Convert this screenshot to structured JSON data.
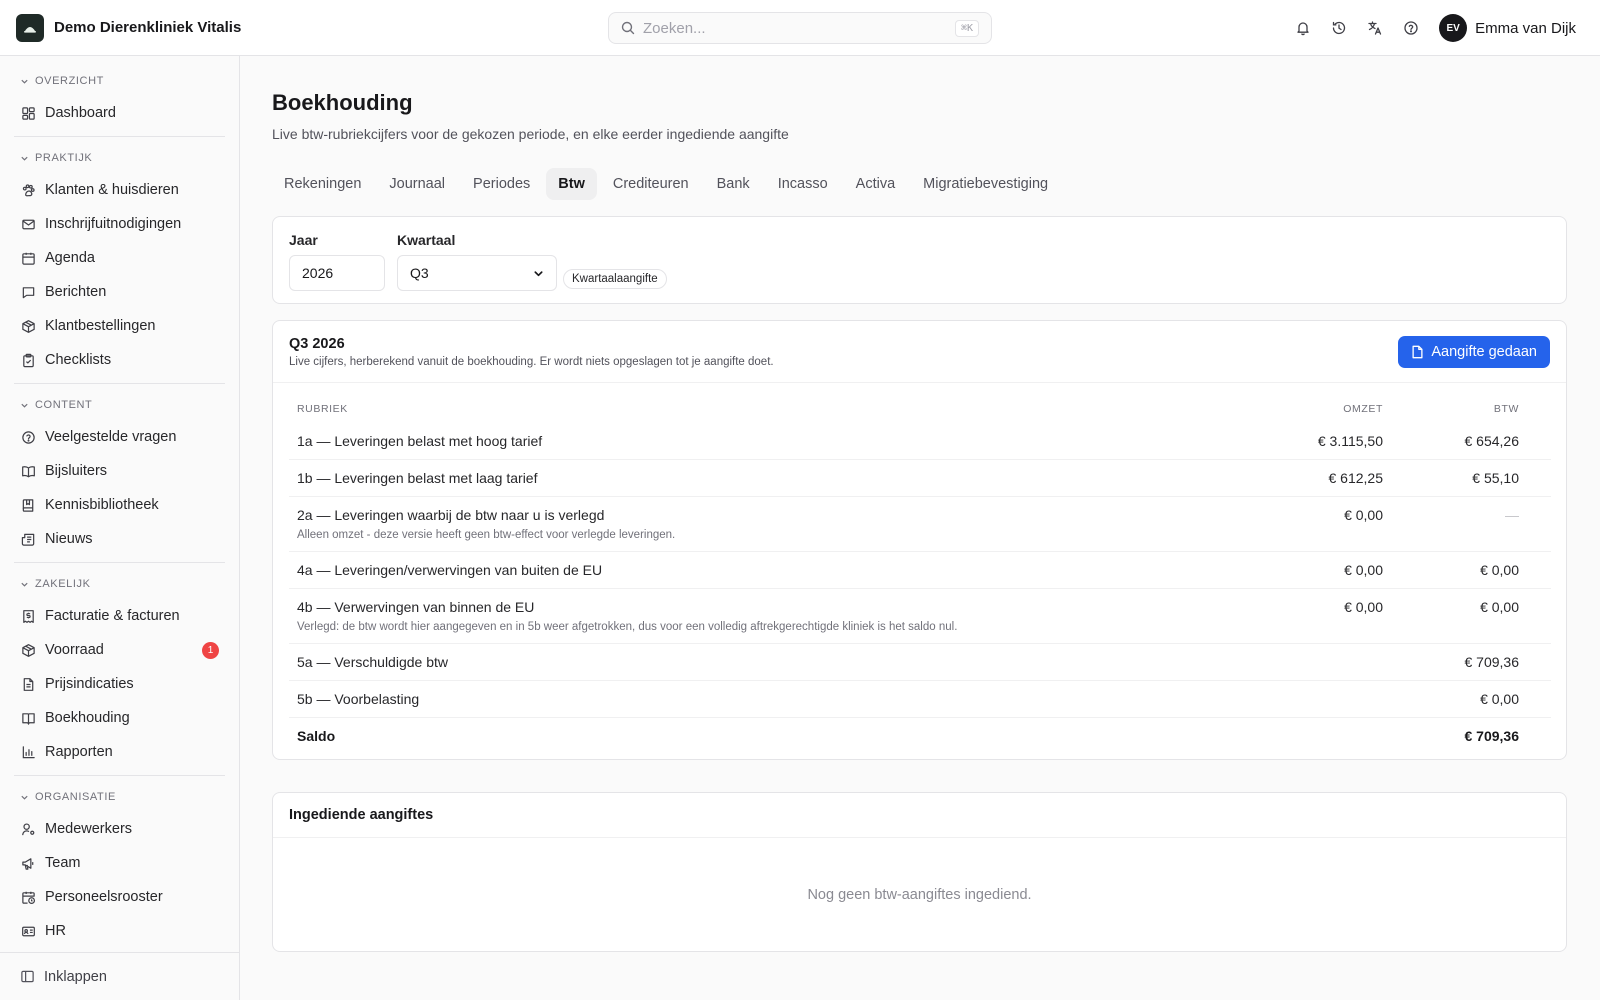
{
  "app": {
    "name": "Demo Dierenkliniek Vitalis"
  },
  "search": {
    "placeholder": "Zoeken...",
    "shortcut": "⌘K"
  },
  "user": {
    "initials": "EV",
    "name": "Emma van Dijk"
  },
  "topbar_icons": [
    "bell-icon",
    "history-icon",
    "translate-icon",
    "help-icon"
  ],
  "sidebar": {
    "sections": [
      {
        "label": "OVERZICHT",
        "items": [
          {
            "label": "Dashboard",
            "icon": "dashboard-icon"
          }
        ]
      },
      {
        "label": "PRAKTIJK",
        "items": [
          {
            "label": "Klanten & huisdieren",
            "icon": "paw-icon"
          },
          {
            "label": "Inschrijfuitnodigingen",
            "icon": "mail-icon"
          },
          {
            "label": "Agenda",
            "icon": "calendar-icon"
          },
          {
            "label": "Berichten",
            "icon": "chat-icon"
          },
          {
            "label": "Klantbestellingen",
            "icon": "package-icon"
          },
          {
            "label": "Checklists",
            "icon": "clipboard-check-icon"
          }
        ]
      },
      {
        "label": "CONTENT",
        "items": [
          {
            "label": "Veelgestelde vragen",
            "icon": "question-icon"
          },
          {
            "label": "Bijsluiters",
            "icon": "book-open-icon"
          },
          {
            "label": "Kennisbibliotheek",
            "icon": "book-icon"
          },
          {
            "label": "Nieuws",
            "icon": "newspaper-icon"
          }
        ]
      },
      {
        "label": "ZAKELIJK",
        "items": [
          {
            "label": "Facturatie & facturen",
            "icon": "invoice-icon"
          },
          {
            "label": "Voorraad",
            "icon": "package-icon",
            "badge": "1"
          },
          {
            "label": "Prijsindicaties",
            "icon": "document-icon"
          },
          {
            "label": "Boekhouding",
            "icon": "ledger-icon"
          },
          {
            "label": "Rapporten",
            "icon": "bar-chart-icon"
          }
        ]
      },
      {
        "label": "ORGANISATIE",
        "items": [
          {
            "label": "Medewerkers",
            "icon": "user-cog-icon"
          },
          {
            "label": "Team",
            "icon": "megaphone-icon"
          },
          {
            "label": "Personeelsrooster",
            "icon": "calendar-clock-icon"
          },
          {
            "label": "HR",
            "icon": "id-card-icon"
          }
        ]
      }
    ],
    "collapse_label": "Inklappen"
  },
  "page": {
    "title": "Boekhouding",
    "subtitle": "Live btw-rubriekcijfers voor de gekozen periode, en elke eerder ingediende aangifte"
  },
  "tabs": [
    {
      "label": "Rekeningen",
      "active": false
    },
    {
      "label": "Journaal",
      "active": false
    },
    {
      "label": "Periodes",
      "active": false
    },
    {
      "label": "Btw",
      "active": true
    },
    {
      "label": "Crediteuren",
      "active": false
    },
    {
      "label": "Bank",
      "active": false
    },
    {
      "label": "Incasso",
      "active": false
    },
    {
      "label": "Activa",
      "active": false
    },
    {
      "label": "Migratiebevestiging",
      "active": false
    }
  ],
  "filters": {
    "year_label": "Jaar",
    "year_value": "2026",
    "quarter_label": "Kwartaal",
    "quarter_value": "Q3",
    "chip": "Kwartaalaangifte"
  },
  "btw": {
    "title": "Q3 2026",
    "subtitle": "Live cijfers, herberekend vanuit de boekhouding. Er wordt niets opgeslagen tot je aangifte doet.",
    "button": "Aangifte gedaan",
    "columns": {
      "rubriek": "RUBRIEK",
      "omzet": "OMZET",
      "btw": "BTW"
    },
    "rows": [
      {
        "label": "1a — Leveringen belast met hoog tarief",
        "omzet": "€ 3.115,50",
        "btw": "€ 654,26"
      },
      {
        "label": "1b — Leveringen belast met laag tarief",
        "omzet": "€ 612,25",
        "btw": "€ 55,10"
      },
      {
        "label": "2a — Leveringen waarbij de btw naar u is verlegd",
        "note": "Alleen omzet - deze versie heeft geen btw-effect voor verlegde leveringen.",
        "omzet": "€ 0,00",
        "btw": "—"
      },
      {
        "label": "4a — Leveringen/verwervingen van buiten de EU",
        "omzet": "€ 0,00",
        "btw": "€ 0,00"
      },
      {
        "label": "4b — Verwervingen van binnen de EU",
        "note": "Verlegd: de btw wordt hier aangegeven en in 5b weer afgetrokken, dus voor een volledig aftrekgerechtigde kliniek is het saldo nul.",
        "omzet": "€ 0,00",
        "btw": "€ 0,00"
      },
      {
        "label": "5a — Verschuldigde btw",
        "omzet": "",
        "btw": "€ 709,36"
      },
      {
        "label": "5b — Voorbelasting",
        "omzet": "",
        "btw": "€ 0,00"
      }
    ],
    "total": {
      "label": "Saldo",
      "btw": "€ 709,36"
    }
  },
  "submitted": {
    "title": "Ingediende aangiftes",
    "empty": "Nog geen btw-aangiftes ingediend."
  },
  "colors": {
    "primary": "#2563eb",
    "badge": "#ef4444",
    "brand_logo_bg": "#1f2a27"
  }
}
